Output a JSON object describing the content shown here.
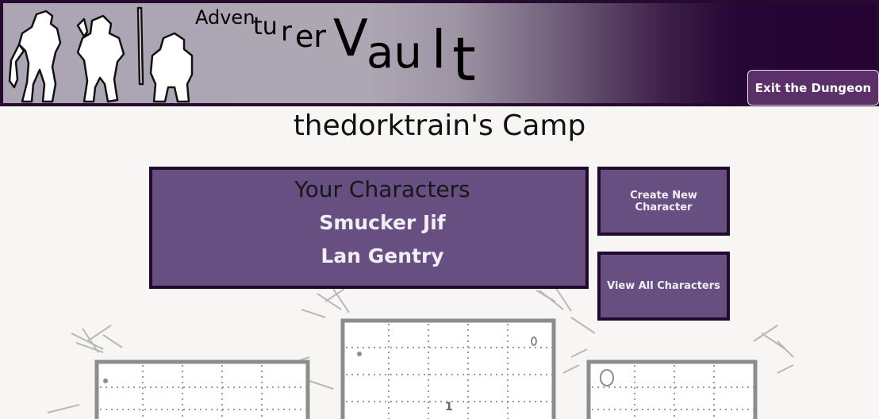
{
  "header": {
    "title_parts": [
      "Adven",
      "tu",
      "r",
      "er",
      "V",
      "au",
      "l",
      "t"
    ],
    "exit_label": "Exit the Dungeon"
  },
  "page": {
    "camp_title": "thedorktrain's Camp"
  },
  "characters": {
    "heading": "Your Characters",
    "names": [
      "Smucker Jif",
      "Lan Gentry"
    ]
  },
  "actions": {
    "create_label": "Create New Character",
    "view_label": "View All Characters"
  },
  "map": {
    "room_number": "1"
  },
  "colors": {
    "panel": "#674f81",
    "border": "#230a2d",
    "banner_dark": "#250433",
    "button": "#5b2f68"
  }
}
